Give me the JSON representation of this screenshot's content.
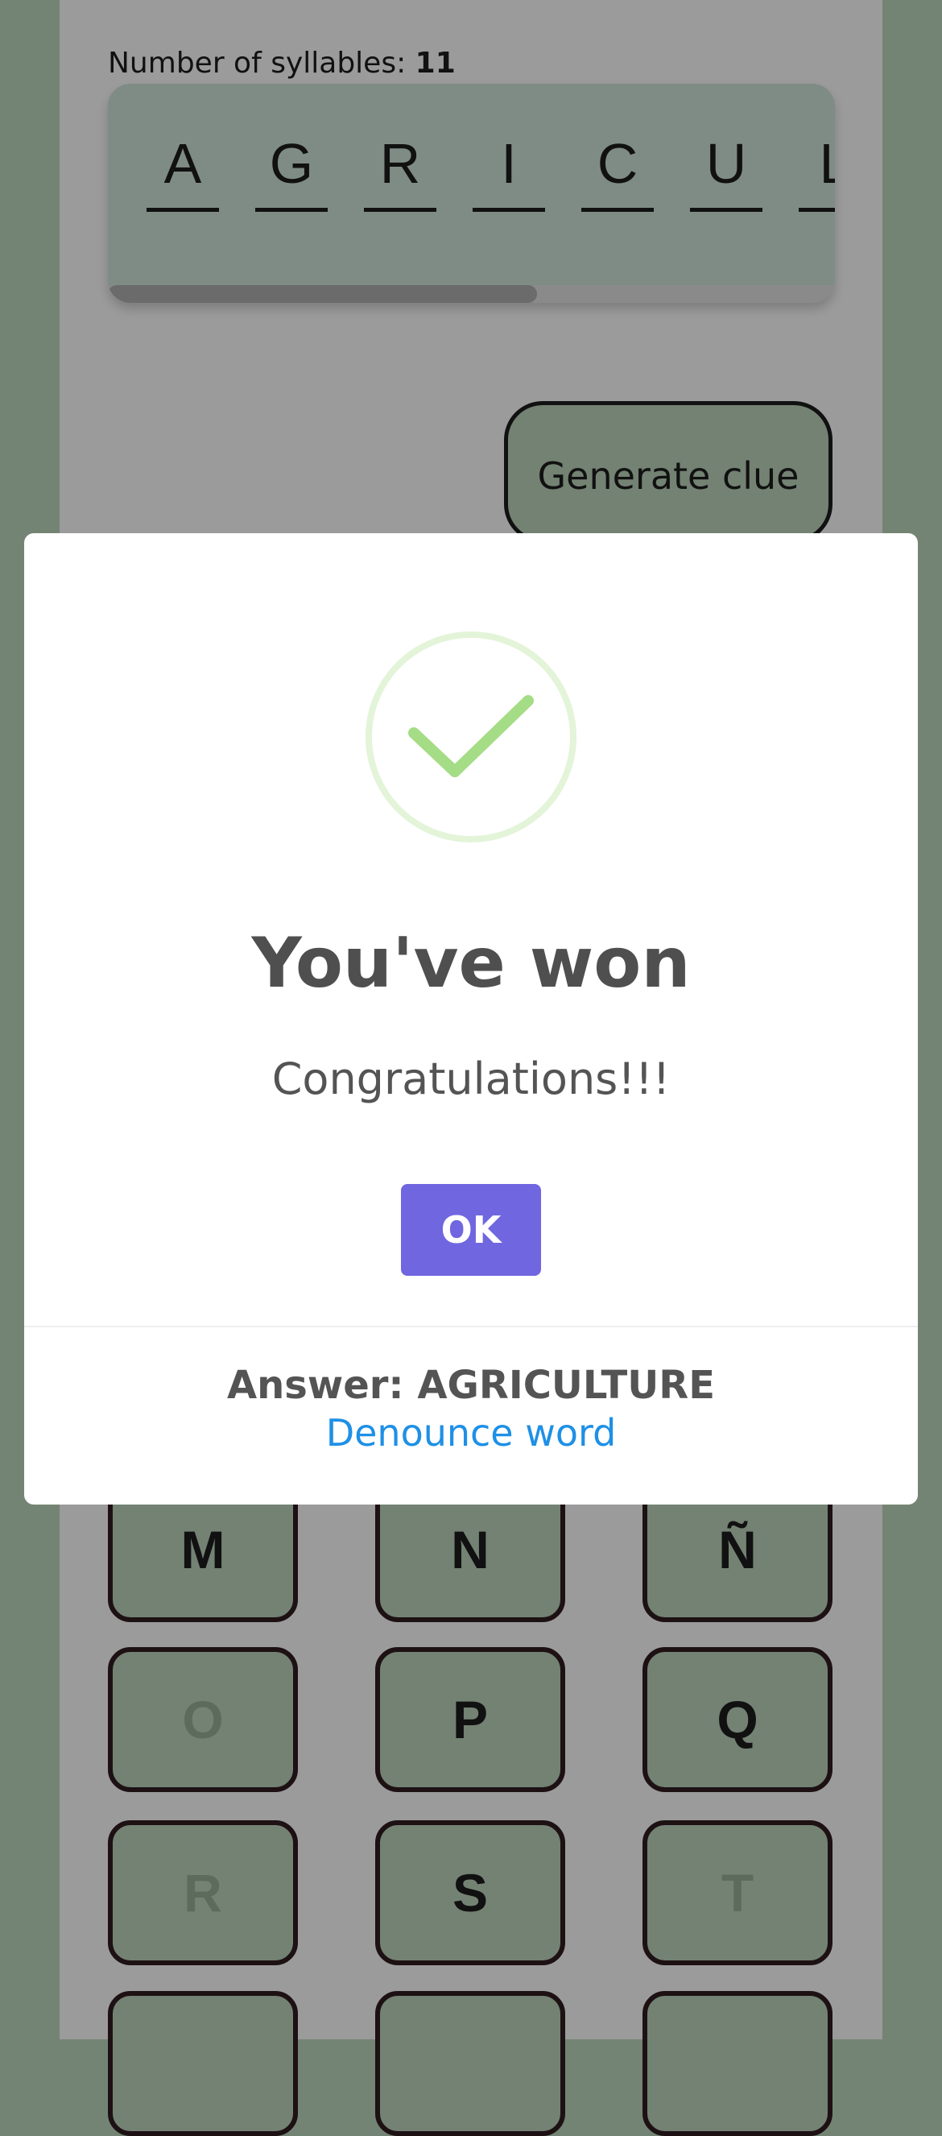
{
  "syllables": {
    "label": "Number of syllables: ",
    "count": "11"
  },
  "word_letters": [
    "A",
    "G",
    "R",
    "I",
    "C",
    "U",
    "L"
  ],
  "word_scroll_progress": 0.59,
  "clue_button": "Generate clue",
  "keyboard": [
    {
      "label": "M",
      "used": false
    },
    {
      "label": "N",
      "used": false
    },
    {
      "label": "Ñ",
      "used": false
    },
    {
      "label": "O",
      "used": true
    },
    {
      "label": "P",
      "used": false
    },
    {
      "label": "Q",
      "used": false
    },
    {
      "label": "R",
      "used": true
    },
    {
      "label": "S",
      "used": false
    },
    {
      "label": "T",
      "used": true
    }
  ],
  "modal": {
    "icon": "success-check-icon",
    "title": "You've won",
    "message": "Congratulations!!!",
    "ok_label": "OK",
    "answer": "Answer: AGRICULTURE",
    "denounce_label": "Denounce word"
  },
  "colors": {
    "background": "#748474",
    "overlay_page": "#9b9b9b",
    "ok_button": "#7066e0",
    "link": "#1e90e6",
    "success": "#a5dc86"
  }
}
